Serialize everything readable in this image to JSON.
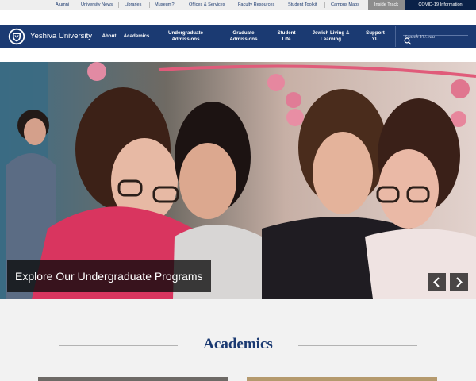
{
  "utility_bar": {
    "links": [
      "Alumni",
      "University News",
      "Libraries",
      "Museum?",
      "Offices & Services",
      "Faculty Resources",
      "Student Toolkit",
      "Campus Maps"
    ],
    "inside_track": "Inside Track",
    "covid": "COVID-19 Information"
  },
  "header": {
    "brand": "Yeshiva University",
    "nav": [
      "About",
      "Academics",
      "Undergraduate\nAdmissions",
      "Graduate\nAdmissions",
      "Student\nLife",
      "Jewish Living &\nLearning",
      "Support\nYU"
    ],
    "search_placeholder": "Search YU.edu"
  },
  "hero": {
    "caption": "Explore Our Undergraduate Programs",
    "prev_icon": "chevron-left-icon",
    "next_icon": "chevron-right-icon"
  },
  "academics": {
    "title": "Academics"
  },
  "colors": {
    "brand_navy": "#1b3a72",
    "utility_bg": "#eeeeee",
    "covid_bg": "#0a2148",
    "inside_track_bg": "#8d8d8d",
    "section_bg": "#f2f2f2"
  }
}
